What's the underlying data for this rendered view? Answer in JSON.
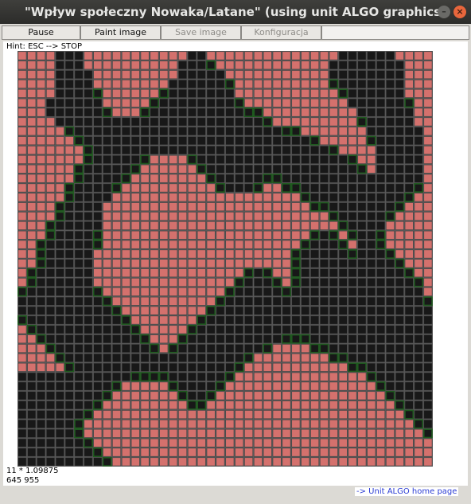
{
  "window": {
    "title": "\"Wpływ społeczny Nowaka/Latane\" (using unit ALGO graphics)",
    "minimize_glyph": "–",
    "close_glyph": "×"
  },
  "toolbar": {
    "pause_label": "Pause",
    "paint_label": "Paint image",
    "save_label": "Save image",
    "config_label": "Konfiguracja"
  },
  "hint": "Hint: ESC --> STOP",
  "status": {
    "line1": "11  *  1.09875",
    "line2": "645  955"
  },
  "home_link": "-> Unit ALGO home page",
  "colors": {
    "pink_cell": "#d4716d",
    "black_cell": "#181818",
    "green_border": "#1f5a1f",
    "link": "#2b3cd4"
  },
  "grid": {
    "cols": 44,
    "rows": 44,
    "legend": "P = pink (opinion A), B = black (opinion B), lowercase = green-bordered (changed this step)",
    "rows_data": [
      "PPPPBBBPPPPPPPPPPPBBPPPPPPPPPPPPPPBBBBBBPPPP",
      "PPPPBBBPPPPPPPPPPBBBbPPPPPPPPPPPPBBBBBBBBPPP",
      "PPPPBBBBPPPPPPPPPBBBBBPPPPPPPPPPPBBBBBBBBPPP",
      "PPPPBBBBPPPPPPPPBBBBBBbPPPPPPPPPPbBBBBBBBPPP",
      "PPPPBBBBbPPPPPPbBBBBBBBPPPPPPPPPPPbBBBBBBPPP",
      "PPPBBBBBBPPPPPbBBBBBBBBbPPPPPPPPPPPBBBBBBbPP",
      "PPPBBBBBBbPPPbBBBBBBBBBBbbPPPPPPPPPPBBBBBBPP",
      "PPPPBBBBBBBBBBBBBBBBBBBBBBbPPPPPPPPPbBBBBBPP",
      "PPPPPbBBBBBBBBBBBBBBBBBBBBBBbbPPPPPPPBBBBBBP",
      "PPPPPPbBBBBBBBBBBBBBBBBBBBBBBBBbPPPPPbBBBBBP",
      "PPPPPPPbBBBBBBBBBBBBBBBBBBBBBBBBBbPPPPBBBBBP",
      "PPPPPPPbBBBBBbPPPPbBBBBBBBBBBBBBBBBbPPBBBBBP",
      "PPPPPPbBBBBBbPPPPPPbBBBBBBBBBBBBBBBBbPBBBBBP",
      "PPPPPPbBBBBbPPPPPPPPbBBBBBbbBBBBBBBBBBBBBBBP",
      "PPPPPbBBBBbPPPPPPPPPPbBBBbPPbbBBBBBBBBBBBBbP",
      "PPPPPbBBBBPPPPPPPPPPPPPPPPPPPPbBBBBBBBBBBbPP",
      "PPPPbBBBBPPPPPPPPPPPPPPPPPPPPPPbbBBBBBBBbPPP",
      "PPPPbBBBBPPPPPPPPPPPPPPPPPPPPPPPPbBBBBBbPPPP",
      "PPPbBBBBBPPPPPPPPPPPPPPPPPPPPPPPPPbBBBBPPPPP",
      "PPPbBBBBbPPPPPPPPPPPPPPPPPPPPPPbBbPbBBbPPPPP",
      "PPbBBBBBbPPPPPPPPPPPPPPPPPPPPPbBBBbPBBbPPPPP",
      "PPbBBBBBPPPPPPPPPPPPPPPPPPPPPbBBBBBbBBBbPPPP",
      "PPbBBBBBPPPPPPPPPPPPPPPPPPPPPbBBBBBBBBBBbPPP",
      "PbBBBBBBPPPPPPPPPPPPPPPPbBbPPbBBBBBBBBBBBbPP",
      "PbBBBBBBPPPPPPPPPPPPPPPbBBBbPbBBBBBBBBBBBBbP",
      "bBBBBBBBbPPPPPPPPPPPPPbBBBBBbBBBBBBBBBBBBBBP",
      "BBBBBBBBBbPPPPPPPPPPPbBBBBBBBBBBBBBBBBBBBBBb",
      "BBBBBBBBBBbPPPPPPPPPbBBBBBBBBBBBBBBBBBBBBBBB",
      "bBBBBBBBBBBbPPPPPPPbBBBBBBBBBBBBBBBBBBBBBBBB",
      "PbBBBBBBBBBBbPPPPPbBBBBBBBBBBBBBBBBBBBBBBBBB",
      "PPbBBBBBBBBBBbPPPbBBBBBBBBBBbbbBBBBBBBBBBBBB",
      "PPPbBBBBBBBBBBbPbBBBBBBBBBbPPPPbbBBBBBBBBBBB",
      "PPPPbBBBBBBBBBBBBBBBBBBBbPPPPPPPPbbBBBBBBBBB",
      "PPPPPbBBBBBBBBBBBBBBBBBbPPPPPPPPPPPbbBBBBBBB",
      "BBBBBBBBBBBBbbbbBBBBBBbPPPPPPPPPPPPPPbBBBBBB",
      "BBBBBBBBBBbPPPPPbBBBBbPPPPPPPPPPPPPPPPbBBBBB",
      "BBBBBBBBBbPPPPPPPbBBbPPPPPPPPPPPPPPPPPPbBBBB",
      "BBBBBBBBbPPPPPPPPPbbPPPPPPPPPPPPPPPPPPPPbBBB",
      "BBBBBBBbPPPPPPPPPPPPPPPPPPPPPPPPPPPPPPPPPbBB",
      "BBBBBBbPPPPPPPPPPPPPPPPPPPPPPPPPPPPPPPPPPPbB",
      "BBBBBBbPPPPPPPPPPPPPPPPPPPPPPPPPPPPPPPPPPPPb",
      "BBBBBBBbPPPPPPPPPPPPPPPPPPPPPPPPPPPPPPPPPPPP",
      "BBBBBBBBbPPPPPPPPPPPPPPPPPPPPPPPPPPPPPPPPPPP",
      "BBBBBBBBBbPPPPPPPPPPPPPPPPPPPPPPPPPPPPPPPPPP"
    ]
  }
}
